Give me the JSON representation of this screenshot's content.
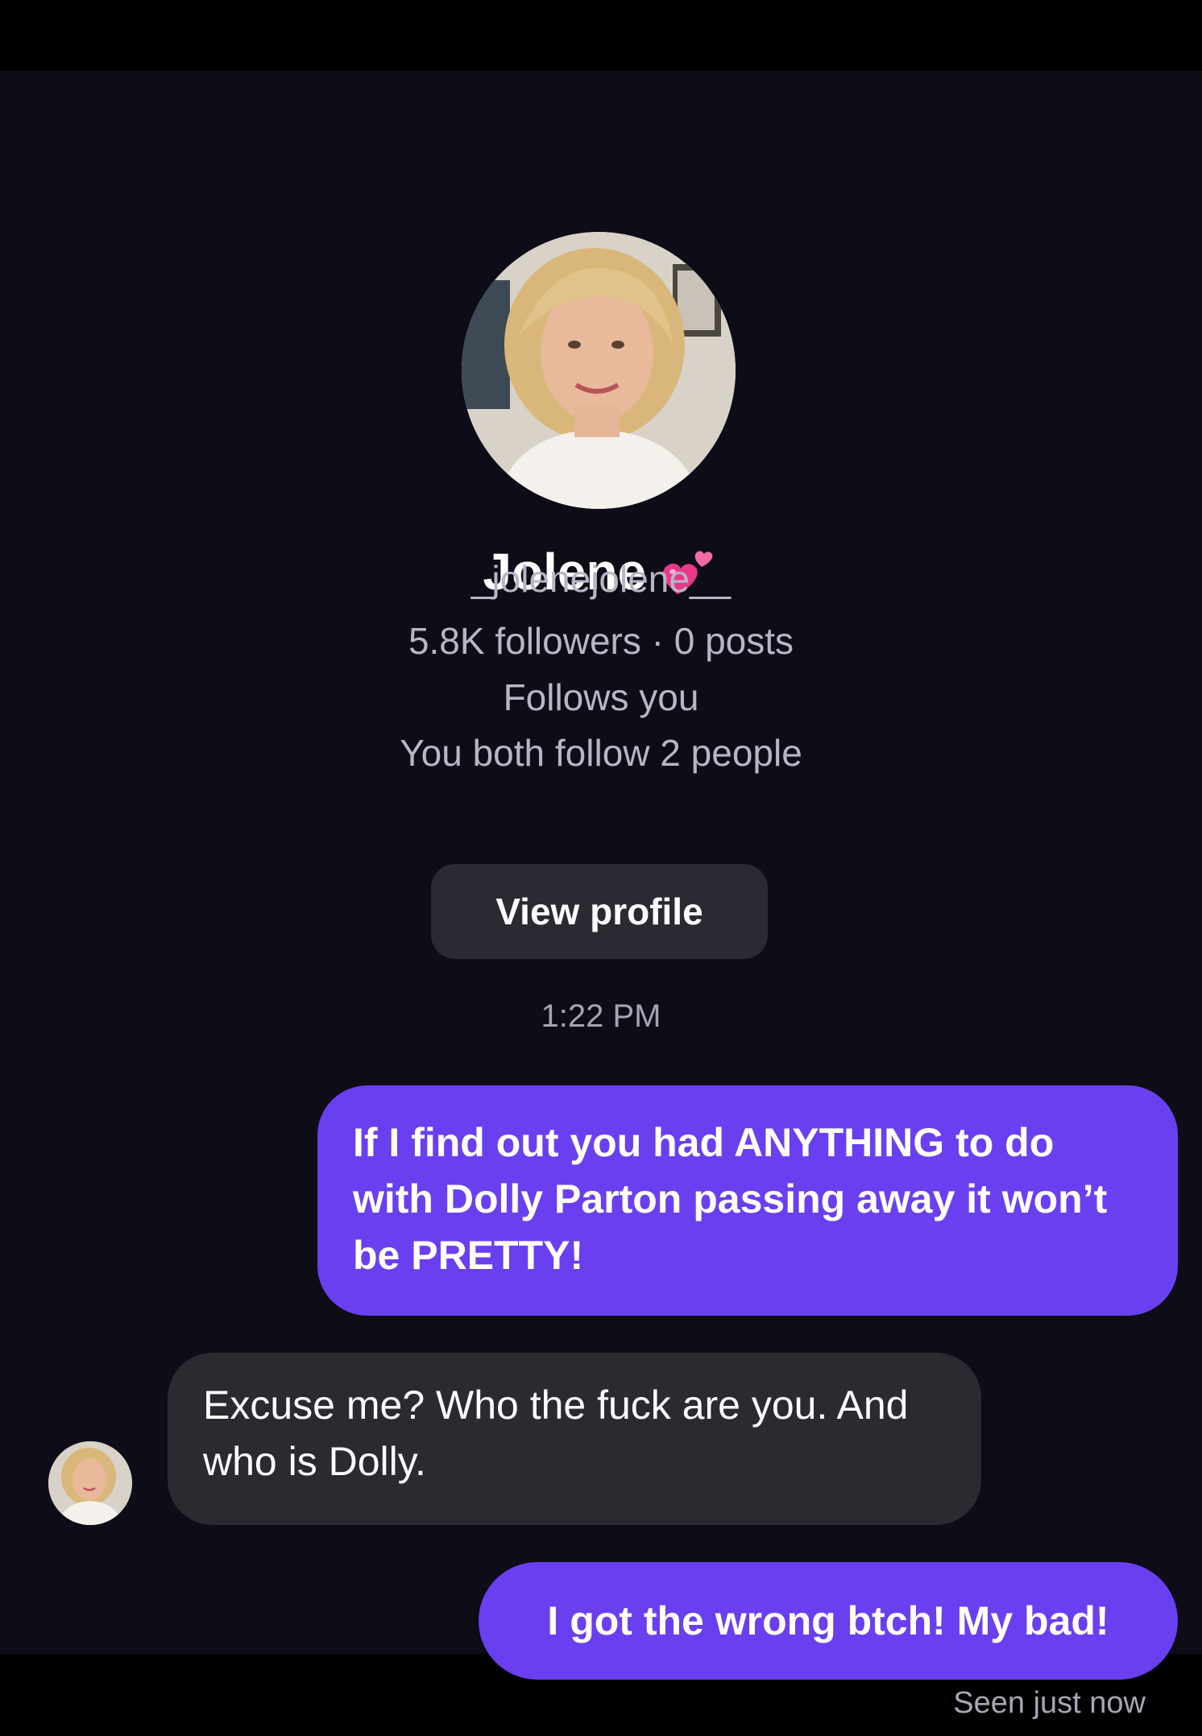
{
  "profile": {
    "name": "Jolene",
    "name_emoji_icon": "two-hearts-icon",
    "username": "_jolenejolene__",
    "stats": "5.8K followers · 0 posts",
    "follows_you": "Follows you",
    "mutual": "You both follow 2 people",
    "view_profile_label": "View profile"
  },
  "conversation": {
    "timestamp": "1:22 PM",
    "messages": [
      {
        "direction": "outgoing",
        "text": "If I find out you had ANYTHING to do with Dolly Parton passing away it won’t be PRETTY!"
      },
      {
        "direction": "incoming",
        "text": "Excuse me? Who the fuck are you. And who is Dolly."
      },
      {
        "direction": "outgoing",
        "text": "I got the wrong btch! My bad!"
      }
    ],
    "seen_status": "Seen just now"
  },
  "colors": {
    "background": "#0d0c17",
    "outgoing_bubble": "#6a3ff0",
    "incoming_bubble": "#2a2a31",
    "button": "#2b2a33",
    "secondary_text": "#b8b6c4",
    "hearts": "#e8388a"
  }
}
